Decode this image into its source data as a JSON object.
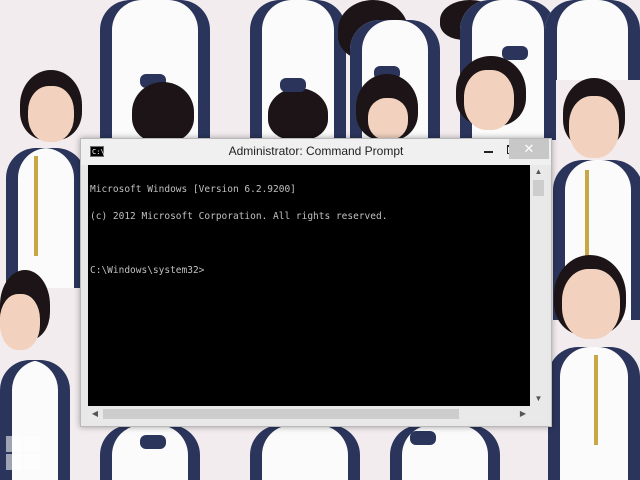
{
  "window": {
    "title": "Administrator: Command Prompt",
    "icon": "cmd-icon",
    "icon_text": "C:\\",
    "controls": {
      "minimize": "minimize-icon",
      "maximize": "maximize-icon",
      "close_label": "✕"
    }
  },
  "console": {
    "lines": [
      "Microsoft Windows [Version 6.2.9200]",
      "(c) 2012 Microsoft Corporation. All rights reserved.",
      "",
      "C:\\Windows\\system32>"
    ]
  },
  "scrollbars": {
    "up_arrow": "▲",
    "down_arrow": "▼",
    "left_arrow": "◀",
    "right_arrow": "▶"
  },
  "colors": {
    "console_background": "#000000",
    "console_text": "#c0c0c0",
    "titlebar": "#f0f0f0",
    "close_button": "#c7c7c7"
  }
}
